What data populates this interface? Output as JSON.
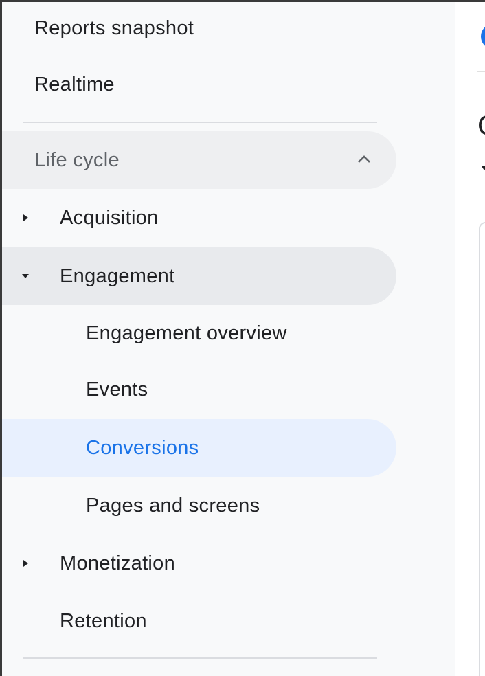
{
  "nav": {
    "reports_snapshot": "Reports snapshot",
    "realtime": "Realtime",
    "life_cycle": "Life cycle",
    "acquisition": "Acquisition",
    "engagement": "Engagement",
    "engagement_overview": "Engagement overview",
    "events": "Events",
    "conversions": "Conversions",
    "pages_and_screens": "Pages and screens",
    "monetization": "Monetization",
    "retention": "Retention"
  },
  "content": {
    "heading_fragment": "C"
  },
  "colors": {
    "accent": "#1a73e8",
    "selected_bg": "#e8f0fe",
    "sidebar_bg": "#f8f9fa"
  }
}
